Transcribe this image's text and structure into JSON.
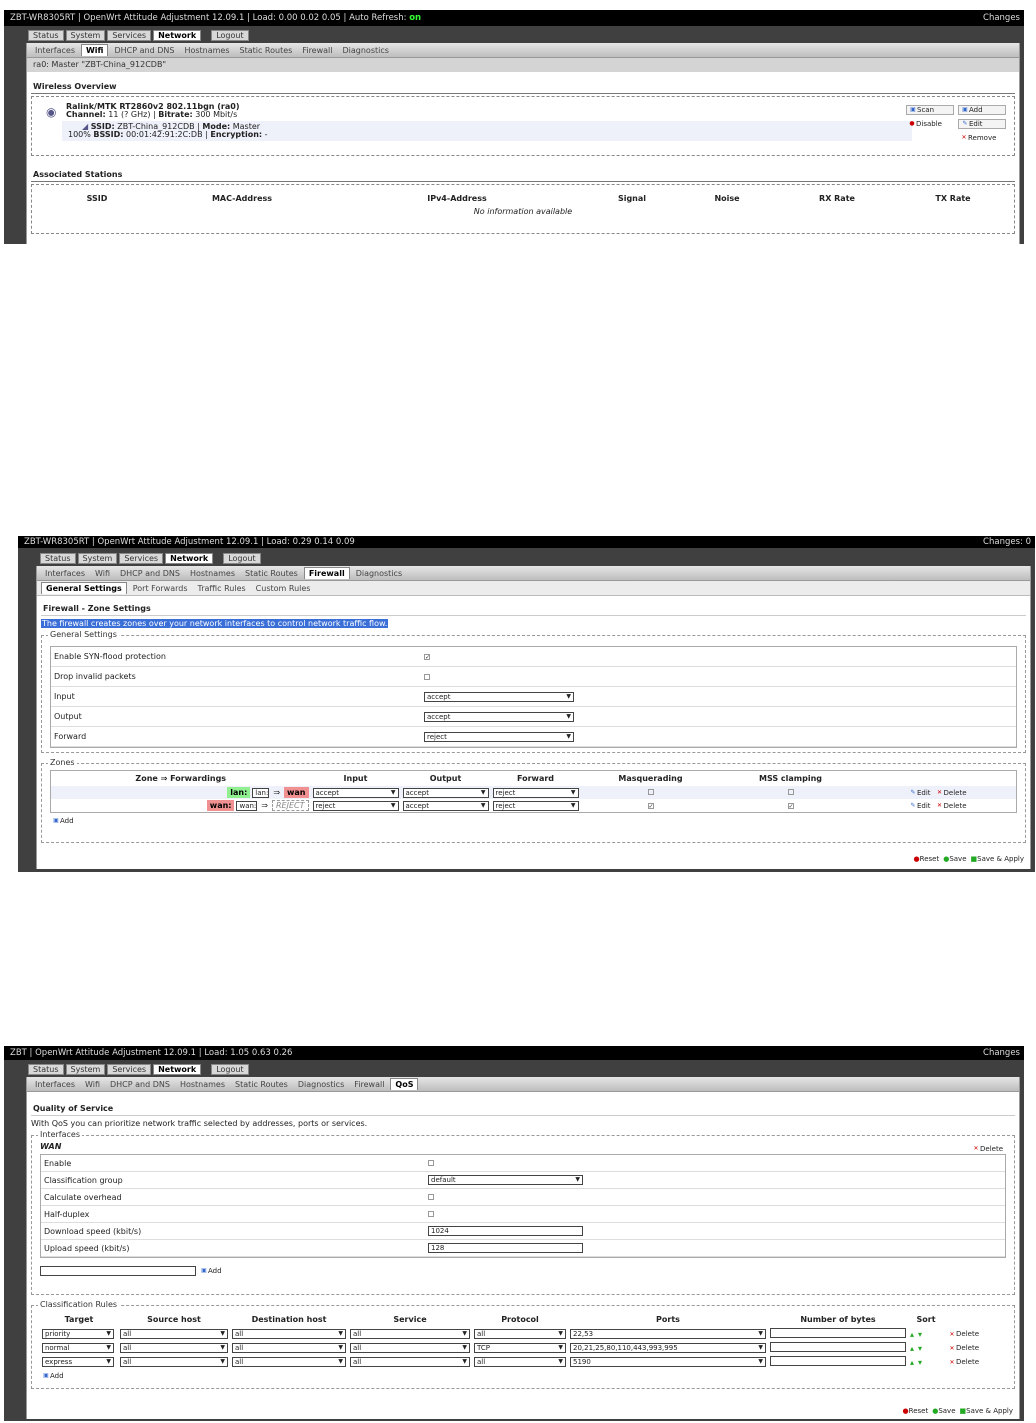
{
  "s1": {
    "topbar": {
      "left": "ZBT-WR8305RT | OpenWrt Attitude Adjustment 12.09.1 | Load: 0.00 0.02 0.05 | Auto Refresh: ",
      "on": "on",
      "right": "Changes"
    },
    "maintabs": [
      "Status",
      "System",
      "Services",
      "Network",
      "Logout"
    ],
    "subtabs": [
      "Interfaces",
      "Wifi",
      "DHCP and DNS",
      "Hostnames",
      "Static Routes",
      "Firewall",
      "Diagnostics"
    ],
    "info": "ra0: Master \"ZBT-China_912CDB\"",
    "overview_title": "Wireless Overview",
    "device": {
      "name": "Ralink/MTK RT2860v2 802.11bgn (ra0)",
      "channel_label": "Channel:",
      "channel": "11 (? GHz)",
      "bitrate_label": "Bitrate:",
      "bitrate": "300 Mbit/s"
    },
    "net": {
      "ssid_label": "SSID:",
      "ssid": "ZBT-China_912CDB",
      "mode_label": "Mode:",
      "mode": "Master",
      "pct": "100%",
      "bssid_label": "BSSID:",
      "bssid": "00:01:42:91:2C:DB",
      "enc_label": "Encryption:",
      "enc": "-"
    },
    "buttons": {
      "scan": "Scan",
      "add": "Add",
      "disable": "Disable",
      "edit": "Edit",
      "remove": "Remove"
    },
    "stations_title": "Associated Stations",
    "stations_cols": [
      "SSID",
      "MAC-Address",
      "IPv4-Address",
      "Signal",
      "Noise",
      "RX Rate",
      "TX Rate"
    ],
    "no_info": "No information available"
  },
  "s2": {
    "topbar": {
      "left": "ZBT-WR8305RT | OpenWrt Attitude Adjustment 12.09.1 | Load: 0.29 0.14 0.09",
      "right": "Changes: 0"
    },
    "maintabs": [
      "Status",
      "System",
      "Services",
      "Network",
      "Logout"
    ],
    "subtabs": [
      "Interfaces",
      "Wifi",
      "DHCP and DNS",
      "Hostnames",
      "Static Routes",
      "Firewall",
      "Diagnostics"
    ],
    "subtabs2": [
      "General Settings",
      "Port Forwards",
      "Traffic Rules",
      "Custom Rules"
    ],
    "title": "Firewall - Zone Settings",
    "desc": "The firewall creates zones over your network interfaces to control network traffic flow.",
    "gs_legend": "General Settings",
    "gs_rows": [
      {
        "label": "Enable SYN-flood protection",
        "type": "cb",
        "value": "✓"
      },
      {
        "label": "Drop invalid packets",
        "type": "cb",
        "value": ""
      },
      {
        "label": "Input",
        "type": "sel",
        "value": "accept"
      },
      {
        "label": "Output",
        "type": "sel",
        "value": "accept"
      },
      {
        "label": "Forward",
        "type": "sel",
        "value": "reject"
      }
    ],
    "zones_legend": "Zones",
    "zone_cols": [
      "Zone ⇒ Forwardings",
      "Input",
      "Output",
      "Forward",
      "Masquerading",
      "MSS clamping"
    ],
    "zones": [
      {
        "name": "lan:",
        "iface": "lan:",
        "arrow": "⇒",
        "target": "wan",
        "input": "accept",
        "output": "accept",
        "forward": "reject",
        "masq": "",
        "mss": ""
      },
      {
        "name": "wan:",
        "iface": "wan:",
        "arrow": "⇒",
        "target": "REJECT",
        "input": "reject",
        "output": "accept",
        "forward": "reject",
        "masq": "✓",
        "mss": "✓"
      }
    ],
    "edit": "Edit",
    "delete": "Delete",
    "add": "Add",
    "footer": {
      "reset": "Reset",
      "save": "Save",
      "apply": "Save & Apply"
    }
  },
  "s3": {
    "topbar": {
      "left": "ZBT | OpenWrt Attitude Adjustment 12.09.1 | Load: 1.05 0.63 0.26",
      "right": "Changes"
    },
    "maintabs": [
      "Status",
      "System",
      "Services",
      "Network",
      "Logout"
    ],
    "subtabs": [
      "Interfaces",
      "Wifi",
      "DHCP and DNS",
      "Hostnames",
      "Static Routes",
      "Diagnostics",
      "Firewall",
      "QoS"
    ],
    "title": "Quality of Service",
    "desc": "With QoS you can prioritize network traffic selected by addresses, ports or services.",
    "if_legend": "Interfaces",
    "wan": "WAN",
    "delete": "Delete",
    "if_rows": [
      {
        "label": "Enable",
        "type": "cb",
        "value": ""
      },
      {
        "label": "Classification group",
        "type": "sel",
        "value": "default"
      },
      {
        "label": "Calculate overhead",
        "type": "cb",
        "value": ""
      },
      {
        "label": "Half-duplex",
        "type": "cb",
        "value": ""
      },
      {
        "label": "Download speed (kbit/s)",
        "type": "txt",
        "value": "1024"
      },
      {
        "label": "Upload speed (kbit/s)",
        "type": "txt",
        "value": "128"
      }
    ],
    "add": "Add",
    "cr_legend": "Classification Rules",
    "cr_cols": [
      "Target",
      "Source host",
      "Destination host",
      "Service",
      "Protocol",
      "Ports",
      "Number of bytes",
      "Sort"
    ],
    "rules": [
      {
        "target": "priority",
        "src": "all",
        "dst": "all",
        "svc": "all",
        "proto": "all",
        "ports": "22,53",
        "bytes": ""
      },
      {
        "target": "normal",
        "src": "all",
        "dst": "all",
        "svc": "all",
        "proto": "TCP",
        "ports": "20,21,25,80,110,443,993,995",
        "bytes": ""
      },
      {
        "target": "express",
        "src": "all",
        "dst": "all",
        "svc": "all",
        "proto": "all",
        "ports": "5190",
        "bytes": ""
      }
    ],
    "footer": {
      "reset": "Reset",
      "save": "Save",
      "apply": "Save & Apply"
    }
  }
}
